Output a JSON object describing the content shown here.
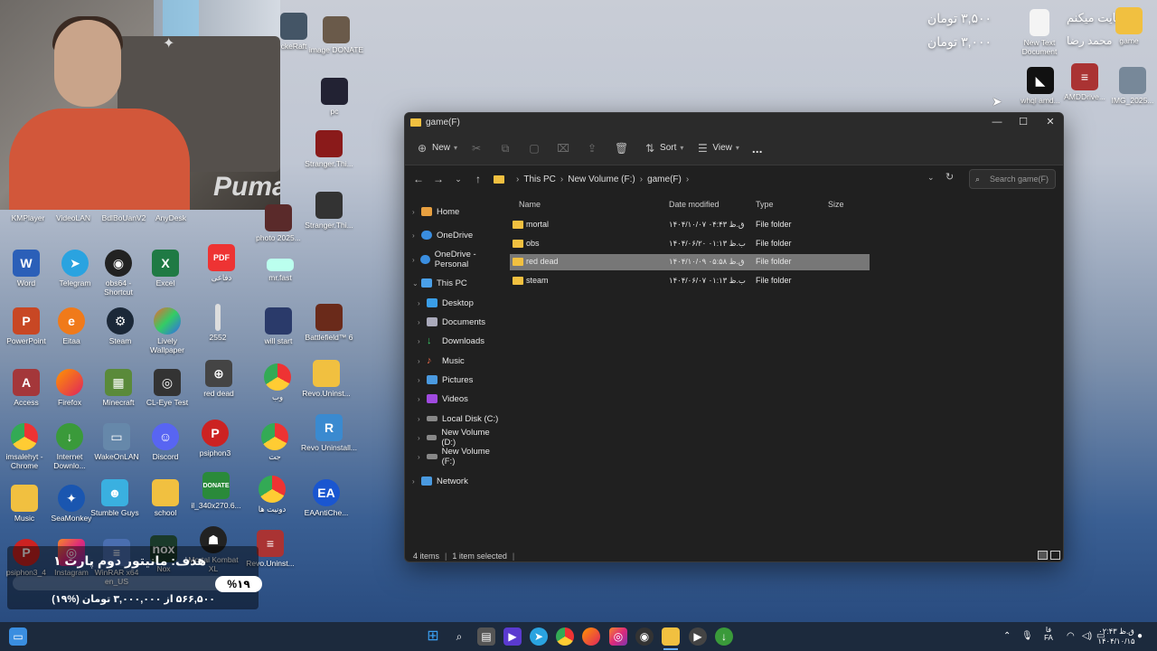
{
  "desktop": {
    "overlay_top_right": {
      "line1_amount": "۳,۵۰۰ تومان",
      "line2_amount": "۳,۰۰۰ تومان",
      "name_text": "حمایت میکنم",
      "name_text2": "محمد رضا"
    },
    "icons": [
      {
        "label": "KMPlayer"
      },
      {
        "label": "VideoLAN"
      },
      {
        "label": "BdlBoUanV2"
      },
      {
        "label": "AnyDesk"
      },
      {
        "label": "Word"
      },
      {
        "label": "Telegram"
      },
      {
        "label": "obs64 - Shortcut"
      },
      {
        "label": "Excel"
      },
      {
        "label": "PowerPoint"
      },
      {
        "label": "Eitaa"
      },
      {
        "label": "Steam"
      },
      {
        "label": "Lively Wallpaper"
      },
      {
        "label": "Access"
      },
      {
        "label": "Firefox"
      },
      {
        "label": "Minecraft"
      },
      {
        "label": "CL-Eye Test"
      },
      {
        "label": "imsalehyt - Chrome"
      },
      {
        "label": "Internet Downlo..."
      },
      {
        "label": "WakeOnLAN"
      },
      {
        "label": "Discord"
      },
      {
        "label": "Music"
      },
      {
        "label": "SeaMonkey"
      },
      {
        "label": "Stumble Guys"
      },
      {
        "label": "school"
      },
      {
        "label": "psiphon3_4"
      },
      {
        "label": "Instagram"
      },
      {
        "label": "WinRAR x64 en_US"
      },
      {
        "label": "Nox"
      },
      {
        "label": "red dead"
      },
      {
        "label": "psiphon3"
      },
      {
        "label": "il_340x270.6..."
      },
      {
        "label": "Mortal Kombat XL"
      },
      {
        "label": "2552"
      },
      {
        "label": "دفاعی"
      },
      {
        "label": "mr.fast"
      },
      {
        "label": "will start"
      },
      {
        "label": "photo 2025..."
      },
      {
        "label": "Stranger.Thi..."
      },
      {
        "label": "Stranger.Thi..."
      },
      {
        "label": "Battlefield™ 6"
      },
      {
        "label": "Revo.Uninst..."
      },
      {
        "label": "Revo Uninstall..."
      },
      {
        "label": "EAAntiChe..."
      },
      {
        "label": "Revo.Uninst..."
      },
      {
        "label": "دونیت ها"
      },
      {
        "label": "جت"
      },
      {
        "label": "وب"
      },
      {
        "label": "image DONATE"
      },
      {
        "label": "pc"
      },
      {
        "label": "ckeRaft"
      },
      {
        "label": "New Text Document"
      },
      {
        "label": "game"
      },
      {
        "label": "AMDDrive..."
      },
      {
        "label": "whql amd..."
      },
      {
        "label": "IMG_2025..."
      }
    ],
    "goal_overlay": {
      "title": "هدف: مانیتور دوم پارت ۱",
      "percent": "%۱۹",
      "progress": 0.19,
      "subtitle": "۵۶۶,۵۰۰ از ۳,۰۰۰,۰۰۰ تومان (%۱۹)"
    }
  },
  "explorer": {
    "window_title": "game(F)",
    "toolbar": {
      "new_label": "New",
      "sort_label": "Sort",
      "view_label": "View",
      "more_label": "..."
    },
    "breadcrumbs": [
      "This PC",
      "New Volume (F:)",
      "game(F)"
    ],
    "search_placeholder": "Search game(F)",
    "nav": {
      "home": "Home",
      "onedrive": "OneDrive",
      "onedrive_personal": "OneDrive - Personal",
      "this_pc": "This PC",
      "desktop": "Desktop",
      "documents": "Documents",
      "downloads": "Downloads",
      "music": "Music",
      "pictures": "Pictures",
      "videos": "Videos",
      "local_disk": "Local Disk (C:)",
      "new_volume_d": "New Volume (D:)",
      "new_volume_f": "New Volume (F:)",
      "network": "Network"
    },
    "columns": {
      "name": "Name",
      "date": "Date modified",
      "type": "Type",
      "size": "Size"
    },
    "rows": [
      {
        "name": "mortal",
        "date": "۱۴۰۴/۱۰/۰۷ ق.ظ ۰۴:۴۳",
        "type": "File folder"
      },
      {
        "name": "obs",
        "date": "۱۴۰۴/۰۶/۲۰ ب.ظ ۰۱:۱۳",
        "type": "File folder"
      },
      {
        "name": "red dead",
        "date": "۱۴۰۴/۱۰/۰۹ ق.ظ ۰۵:۵۸",
        "type": "File folder"
      },
      {
        "name": "steam",
        "date": "۱۴۰۴/۰۶/۰۷ ب.ظ ۰۱:۱۳",
        "type": "File folder"
      }
    ],
    "status": {
      "items": "4 items",
      "selected": "1 item selected"
    }
  },
  "taskbar": {
    "clock_time": "۰۲:۴۳ ق.ظ",
    "clock_date": "۱۴۰۴/۱۰/۱۵",
    "lang": "FA",
    "lang_top": "فا"
  },
  "colors": {
    "explorer_bg": "#202020",
    "selected_row": "#777777",
    "folder": "#f1c040",
    "taskbar": "#1c2a3d"
  }
}
